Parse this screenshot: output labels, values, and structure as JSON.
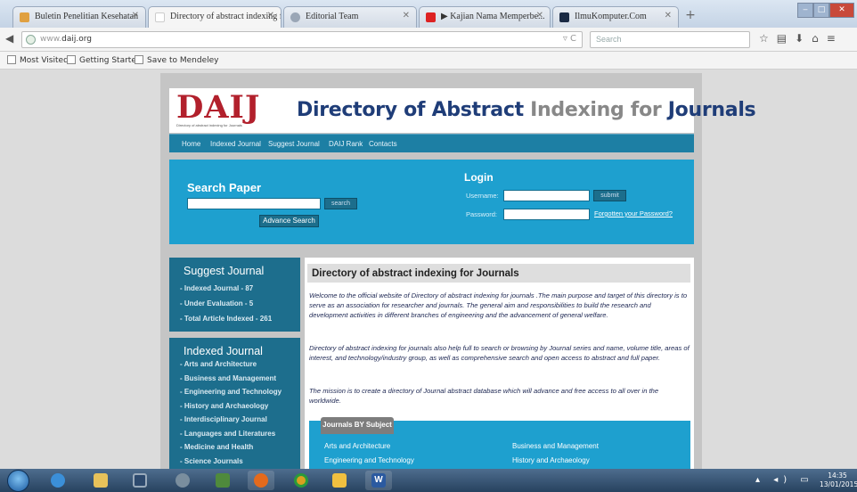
{
  "browser": {
    "tabs": [
      {
        "title": "Buletin Penelitian Kesehatan",
        "color": "#e0a040"
      },
      {
        "title": "Directory of abstract indexing f...",
        "color": "#b2202c"
      },
      {
        "title": "Editorial Team",
        "color": "#9aa6b6"
      },
      {
        "title": "▶ Kajian Nama Memperbe...",
        "color": "#d22"
      },
      {
        "title": "IlmuKomputer.Com",
        "color": "#1a2a44"
      }
    ],
    "url_prefix": "www.",
    "url_domain": "daij.org",
    "search_placeholder": "Search",
    "bookmarks": [
      "Most Visited",
      "Getting Started",
      "Save to Mendeley"
    ]
  },
  "site": {
    "logo_text": "DAIJ",
    "logo_sub": "Directory of abstract indexing for Journals",
    "title_word1": "Directory",
    "title_word2": " of ",
    "title_word3": "Abstract",
    "title_word4": " Indexing ",
    "title_word5": "for ",
    "title_word6": "Journals",
    "menu": [
      "Home",
      "Indexed Journal",
      "Suggest Journal",
      "DAIJ Rank",
      "Contacts"
    ],
    "search": {
      "title": "Search Paper",
      "button": "search",
      "advance_button": "Advance Search"
    },
    "login": {
      "title": "Login",
      "username_label": "Username:",
      "password_label": "Password:",
      "submit": "submit",
      "forgot": "Forgotten your Password?"
    },
    "suggest_box": {
      "title": "Suggest Journal",
      "items": [
        "Indexed Journal - 87",
        "Under Evaluation - 5",
        "Total Article Indexed - 261"
      ]
    },
    "indexed_box": {
      "title": "Indexed Journal",
      "items": [
        "Arts and Architecture",
        "Business and Management",
        "Engineering and Technology",
        "History and Archaeology",
        "Interdisciplinary Journal",
        "Languages and Literatures",
        "Medicine and Health",
        "Science Journals"
      ]
    },
    "content": {
      "title": "Directory of abstract indexing for Journals",
      "para1": "Welcome to the official website of Directory of abstract indexing for journals .The main purpose and target of this directory is to serve as an association for researcher and journals. The general aim and responsibilities to build the research and development activities in different branches of engineering and the advancement of general welfare.",
      "para2": "Directory of abstract indexing for journals also help full to search or browsing by Journal series and name, volume title, areas of interest, and technology/industry group, as well as comprehensive search and open access to abstract and full paper.",
      "para3": "The mission is to create a directory of Journal abstract database which will advance and free access to all over in the worldwide.",
      "subject_tab": "Journals BY Subject",
      "subjects": [
        "Arts and Architecture",
        "Business and Management",
        "Engineering and Technology",
        "History and Archaeology"
      ]
    }
  },
  "taskbar": {
    "time": "14:35",
    "date": "13/01/2015"
  }
}
